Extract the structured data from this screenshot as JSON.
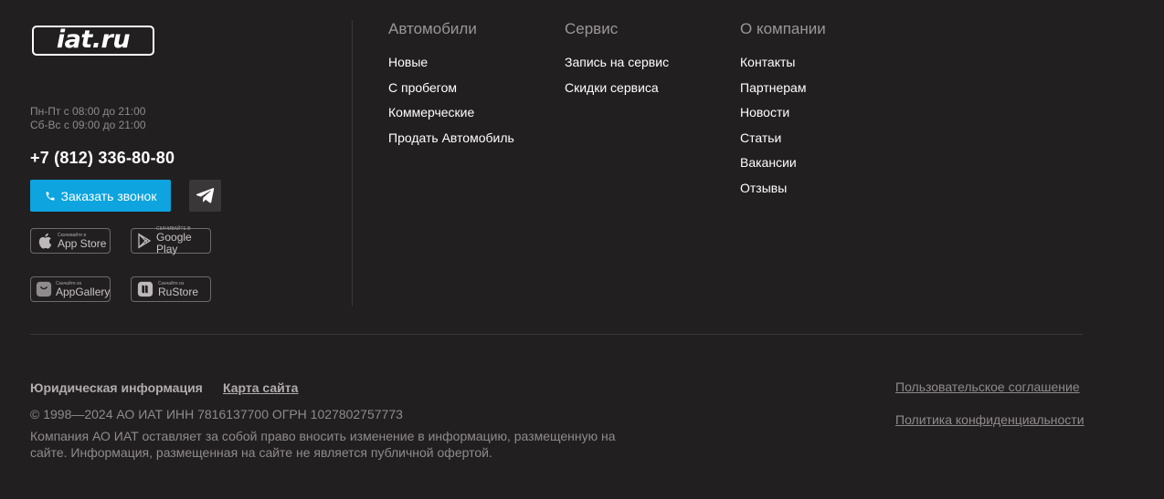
{
  "brand": {
    "logo_text": "iat.ru"
  },
  "hours": {
    "weekdays": "Пн-Пт с 08:00 до 21:00",
    "weekend": "Сб-Вс с 09:00 до 21:00"
  },
  "phone": "+7 (812) 336-80-80",
  "callback_button": {
    "label": "Заказать звонок",
    "icon": "phone-icon"
  },
  "telegram_button": {
    "icon": "telegram-icon"
  },
  "stores": [
    {
      "small": "Скачивайте в",
      "big": "App Store",
      "icon": "apple-icon"
    },
    {
      "small": "СКАЧИВАЙТЕ В",
      "big": "Google Play",
      "icon": "google-play-icon"
    },
    {
      "small": "Скачайте из",
      "big": "AppGallery",
      "icon": "huawei-icon"
    },
    {
      "small": "Скачайте из",
      "big": "RuStore",
      "icon": "rustore-icon"
    }
  ],
  "columns": [
    {
      "heading": "Автомобили",
      "links": [
        "Новые",
        "С пробегом",
        "Коммерческие",
        "Продать Автомобиль"
      ]
    },
    {
      "heading": "Сервис",
      "links": [
        "Запись на сервис",
        "Скидки сервиса"
      ]
    },
    {
      "heading": "О компании",
      "links": [
        "Контакты",
        "Партнерам",
        "Новости",
        "Статьи",
        "Вакансии",
        "Отзывы"
      ]
    }
  ],
  "bottom": {
    "legal_link": "Юридическая информация",
    "sitemap_link": "Карта сайта",
    "copyright": "© 1998—2024 АО ИАТ ИНН 7816137700 ОГРН 1027802757773",
    "disclaimer": "Компания АО ИАТ оставляет за собой право вносить изменение в информацию, размещенную на сайте. Информация, размещенная на сайте не является публичной офертой.",
    "user_agreement": "Пользовательское соглашение",
    "privacy_policy": "Политика конфиденциальности"
  },
  "colors": {
    "background": "#221f20",
    "accent": "#0da4e0"
  }
}
